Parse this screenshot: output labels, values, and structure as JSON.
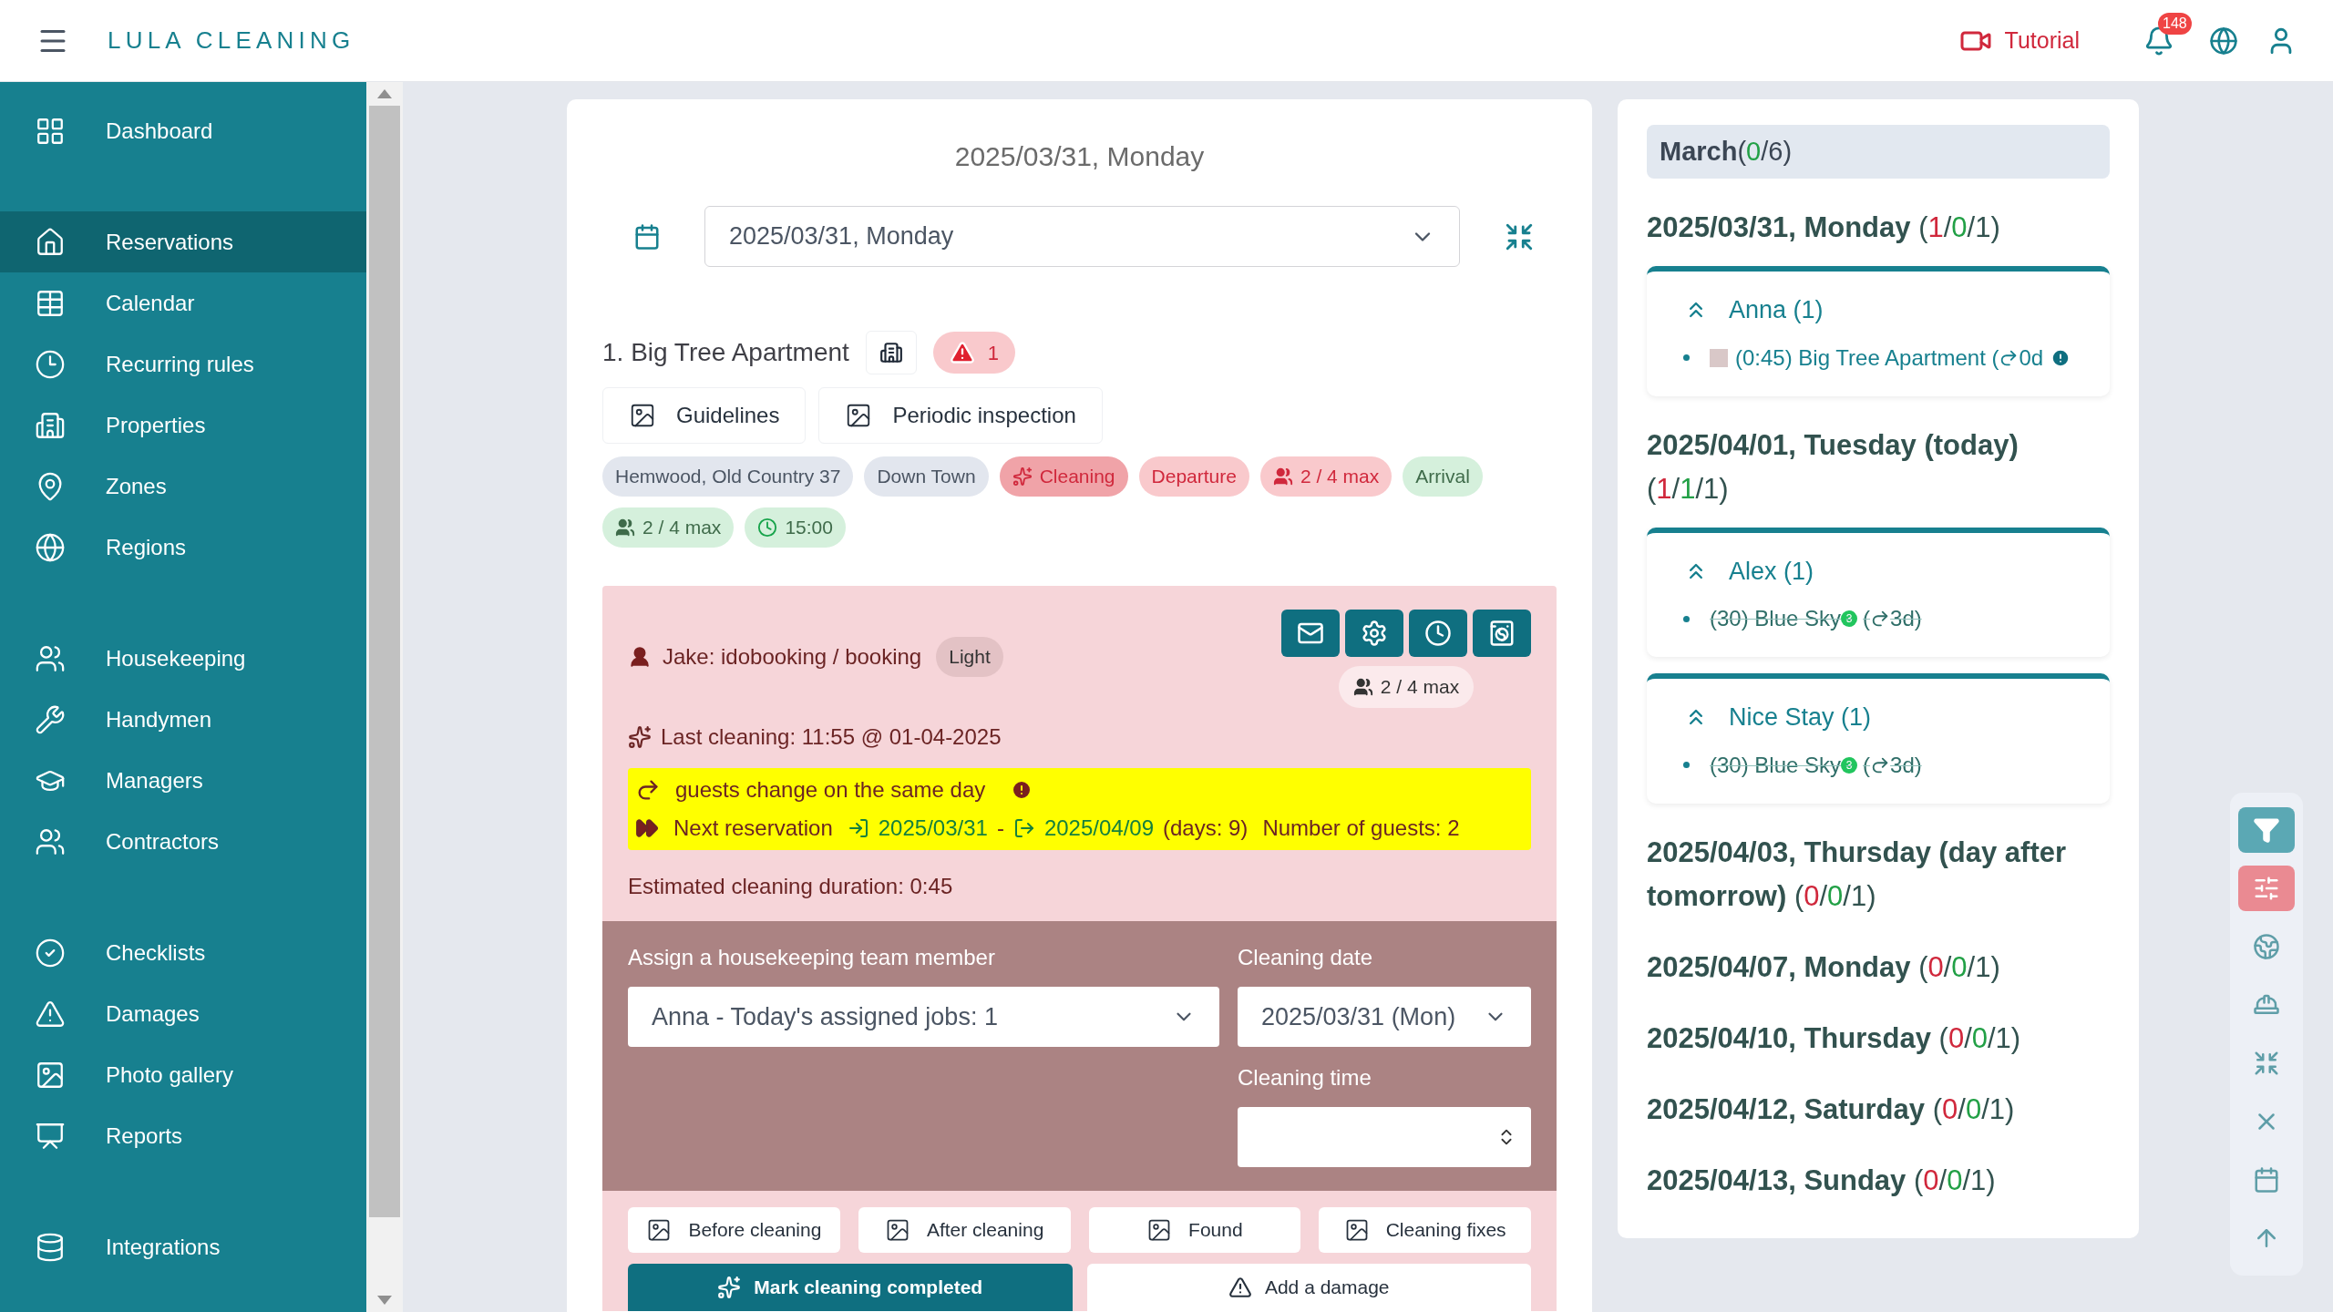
{
  "header": {
    "logo": "LULA CLEANING",
    "tutorial": "Tutorial",
    "notifications": "148"
  },
  "sidebar": {
    "groups": [
      [
        {
          "label": "Dashboard",
          "selected": false
        }
      ],
      [
        {
          "label": "Reservations",
          "selected": true
        },
        {
          "label": "Calendar",
          "selected": false
        },
        {
          "label": "Recurring rules",
          "selected": false
        },
        {
          "label": "Properties",
          "selected": false
        },
        {
          "label": "Zones",
          "selected": false
        },
        {
          "label": "Regions",
          "selected": false
        }
      ],
      [
        {
          "label": "Housekeeping",
          "selected": false
        },
        {
          "label": "Handymen",
          "selected": false
        },
        {
          "label": "Managers",
          "selected": false
        },
        {
          "label": "Contractors",
          "selected": false
        }
      ],
      [
        {
          "label": "Checklists",
          "selected": false
        },
        {
          "label": "Damages",
          "selected": false
        },
        {
          "label": "Photo gallery",
          "selected": false
        },
        {
          "label": "Reports",
          "selected": false
        }
      ],
      [
        {
          "label": "Integrations",
          "selected": false
        }
      ]
    ]
  },
  "main": {
    "title": "2025/03/31, Monday",
    "date_select": "2025/03/31, Monday",
    "property": {
      "name": "1. Big Tree Apartment",
      "alerts": "1",
      "buttons": [
        "Guidelines",
        "Periodic inspection"
      ],
      "tags": [
        {
          "text": "Hemwood, Old Country 37",
          "color": "#e2e6ee",
          "kind": "plain"
        },
        {
          "text": "Down Town",
          "color": "#e2e6ee",
          "kind": "plain"
        },
        {
          "text": "Cleaning",
          "color": "#f0a3a8",
          "kind": "cleaning"
        },
        {
          "text": "Departure",
          "color": "#f9c9cc",
          "kind": "plain"
        },
        {
          "text": "2 / 4 max",
          "color": "#f9c9cc",
          "kind": "guests"
        },
        {
          "text": "Arrival",
          "color": "#d5f0dc",
          "kind": "plain"
        },
        {
          "text": "2 / 4 max",
          "color": "#d5f0dc",
          "kind": "guests"
        },
        {
          "text": "15:00",
          "color": "#d5f0dc",
          "kind": "time"
        }
      ]
    },
    "job": {
      "booker": "Jake: idobooking / booking",
      "level_tag": "Light",
      "guests": "2 / 4 max",
      "last_cleaning": "Last cleaning: 11:55 @ 01-04-2025",
      "notice": "guests change on the same day",
      "next": {
        "label": "Next reservation",
        "from": "2025/03/31",
        "dash": "-",
        "to": "2025/04/09",
        "days": "(days: 9)",
        "guests": "Number of guests: 2"
      },
      "duration": "Estimated cleaning duration: 0:45",
      "assign": {
        "member_label": "Assign a housekeeping team member",
        "member_value": "Anna - Today's assigned jobs: 1",
        "date_label": "Cleaning date",
        "date_value": "2025/03/31 (Mon)",
        "time_label": "Cleaning time"
      },
      "photo_buttons": [
        "Before cleaning",
        "After cleaning",
        "Found",
        "Cleaning fixes"
      ],
      "actions": [
        {
          "text": "Mark cleaning completed",
          "kind": "primary"
        },
        {
          "text": "Add a damage",
          "kind": "secondary"
        }
      ]
    }
  },
  "schedule": {
    "month": {
      "name": "March",
      "count": [
        {
          "text": "("
        },
        {
          "text": "0",
          "color": "#22a046"
        },
        {
          "text": "/6)"
        }
      ]
    },
    "days": [
      {
        "date": "2025/03/31, Monday",
        "count": [
          {
            "text": "("
          },
          {
            "text": "1",
            "color": "#d0283c"
          },
          {
            "text": "/"
          },
          {
            "text": "0",
            "color": "#22a046"
          },
          {
            "text": "/1)"
          }
        ],
        "teams": [
          {
            "name": "Anna (1)",
            "items": [
              {
                "label": "(0:45) Big Tree Apartment (",
                "days": "0d",
                "struck": false,
                "swatch": true,
                "info": true
              }
            ]
          }
        ]
      },
      {
        "date": "2025/04/01, Tuesday (today)",
        "count": [
          {
            "text": "("
          },
          {
            "text": "1",
            "color": "#d0283c"
          },
          {
            "text": "/"
          },
          {
            "text": "1",
            "color": "#22a046"
          },
          {
            "text": "/1)"
          }
        ],
        "teams": [
          {
            "name": "Alex (1)",
            "items": [
              {
                "label": "(30) Blue Sky",
                "badge": "3",
                "lead": "(",
                "days": "3d)",
                "struck": true,
                "swatch": false,
                "info": false
              }
            ]
          },
          {
            "name": "Nice Stay (1)",
            "items": [
              {
                "label": "(30) Blue Sky",
                "badge": "3",
                "lead": "(",
                "days": "3d)",
                "struck": true,
                "swatch": false,
                "info": false
              }
            ]
          }
        ]
      },
      {
        "date": "2025/04/03, Thursday (day after tomorrow)",
        "count": [
          {
            "text": "("
          },
          {
            "text": "0",
            "color": "#d0283c"
          },
          {
            "text": "/"
          },
          {
            "text": "0",
            "color": "#22a046"
          },
          {
            "text": "/1)"
          }
        ]
      },
      {
        "date": "2025/04/07, Monday",
        "count": [
          {
            "text": "("
          },
          {
            "text": "0",
            "color": "#d0283c"
          },
          {
            "text": "/"
          },
          {
            "text": "0",
            "color": "#22a046"
          },
          {
            "text": "/1)"
          }
        ]
      },
      {
        "date": "2025/04/10, Thursday",
        "count": [
          {
            "text": "("
          },
          {
            "text": "0",
            "color": "#d0283c"
          },
          {
            "text": "/"
          },
          {
            "text": "0",
            "color": "#22a046"
          },
          {
            "text": "/1)"
          }
        ]
      },
      {
        "date": "2025/04/12, Saturday",
        "count": [
          {
            "text": "("
          },
          {
            "text": "0",
            "color": "#d0283c"
          },
          {
            "text": "/"
          },
          {
            "text": "0",
            "color": "#22a046"
          },
          {
            "text": "/1)"
          }
        ]
      },
      {
        "date": "2025/04/13, Sunday",
        "count": [
          {
            "text": "("
          },
          {
            "text": "0",
            "color": "#d0283c"
          },
          {
            "text": "/"
          },
          {
            "text": "0",
            "color": "#22a046"
          },
          {
            "text": "/1)"
          }
        ]
      }
    ]
  },
  "tools": [
    {
      "active": true,
      "color": "#5ba8b4"
    },
    {
      "active": true,
      "color": "#ea8a92"
    },
    {
      "active": false
    },
    {
      "active": false
    },
    {
      "active": false
    },
    {
      "active": false
    },
    {
      "active": false
    },
    {
      "active": false
    }
  ]
}
